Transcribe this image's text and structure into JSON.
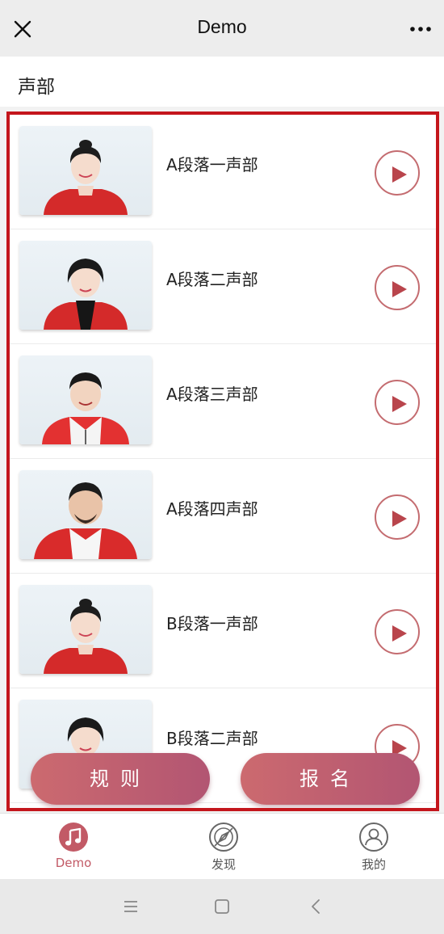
{
  "navbar": {
    "title": "Demo"
  },
  "section": {
    "title": "声部"
  },
  "items": [
    {
      "label": "A段落一声部"
    },
    {
      "label": "A段落二声部"
    },
    {
      "label": "A段落三声部"
    },
    {
      "label": "A段落四声部"
    },
    {
      "label": "B段落一声部"
    },
    {
      "label": "B段落二声部"
    }
  ],
  "actions": {
    "rules_label": "规则",
    "signup_label": "报名"
  },
  "tabbar": {
    "tabs": [
      {
        "label": "Demo",
        "icon": "music-note-icon",
        "active": true
      },
      {
        "label": "发现",
        "icon": "compass-icon",
        "active": false
      },
      {
        "label": "我的",
        "icon": "user-icon",
        "active": false
      }
    ]
  },
  "colors": {
    "accent": "#c25a66",
    "frame": "#c4161c",
    "play_border": "#c46c70"
  }
}
